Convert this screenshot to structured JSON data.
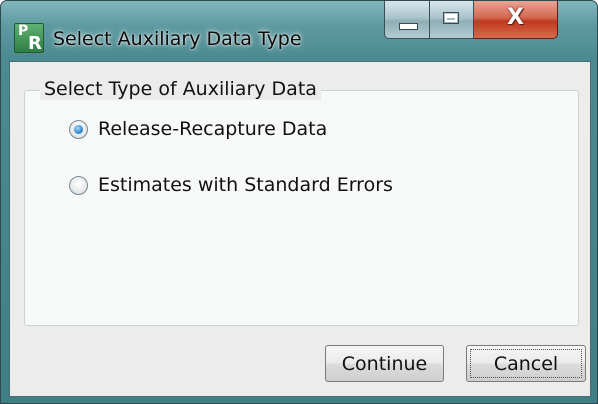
{
  "window": {
    "title": "Select Auxiliary Data Type",
    "app_icon": {
      "letters": [
        "P",
        "R"
      ],
      "icon_name": "pr-app-icon",
      "color": "#2f7f45"
    },
    "caption_buttons": {
      "minimize_icon": "minimize-icon",
      "maximize_icon": "maximize-icon",
      "close_icon": "close-icon",
      "close_glyph": "X"
    }
  },
  "group": {
    "legend": "Select Type of Auxiliary Data",
    "options": [
      {
        "label": "Release-Recapture Data",
        "selected": true
      },
      {
        "label": "Estimates with Standard Errors",
        "selected": false
      }
    ]
  },
  "buttons": {
    "continue_label": "Continue",
    "cancel_label": "Cancel"
  },
  "colors": {
    "frame": "#3f7e85",
    "close": "#c0391f",
    "radio_selected": "#3a8fd1"
  }
}
